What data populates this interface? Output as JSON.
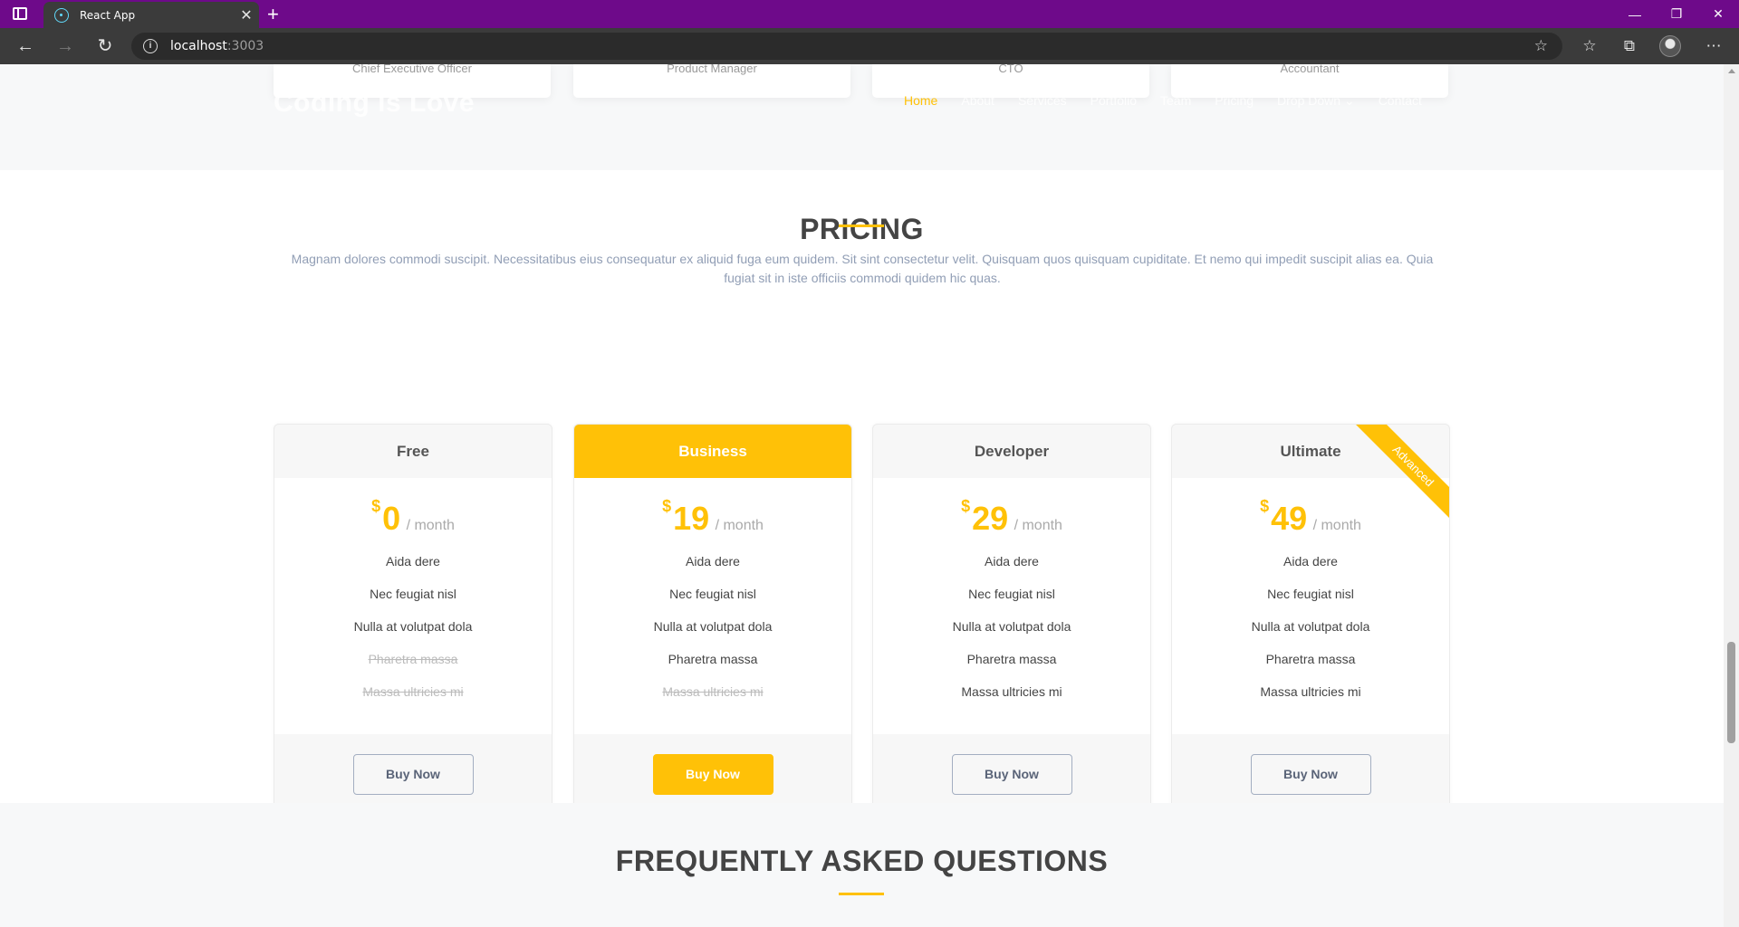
{
  "browser": {
    "tab_title": "React App",
    "tab_close": "✕",
    "new_tab": "+",
    "url_host": "localhost",
    "url_port": ":3003",
    "window": {
      "minimize": "—",
      "restore": "❐",
      "close": "✕"
    }
  },
  "team": {
    "roles": [
      "Chief Executive Officer",
      "Product Manager",
      "CTO",
      "Accountant"
    ]
  },
  "header": {
    "logo": "Coding is Love",
    "nav": [
      "Home",
      "About",
      "Services",
      "Portfolio",
      "Team",
      "Pricing",
      "Drop Down ⌄",
      "Contact"
    ]
  },
  "pricing": {
    "title": "PRICING",
    "description": "Magnam dolores commodi suscipit. Necessitatibus eius consequatur ex aliquid fuga eum quidem. Sit sint consectetur velit. Quisquam quos quisquam cupiditate. Et nemo qui impedit suscipit alias ea. Quia fugiat sit in iste officiis commodi quidem hic quas.",
    "plans": [
      {
        "name": "Free",
        "currency": "$",
        "amount": "0",
        "period": "/ month",
        "cta": "Buy Now",
        "features": [
          "Aida dere",
          "Nec feugiat nisl",
          "Nulla at volutpat dola",
          "Pharetra massa",
          "Massa ultricies mi"
        ],
        "included": [
          true,
          true,
          true,
          false,
          false
        ]
      },
      {
        "name": "Business",
        "currency": "$",
        "amount": "19",
        "period": "/ month",
        "cta": "Buy Now",
        "featured": true,
        "features": [
          "Aida dere",
          "Nec feugiat nisl",
          "Nulla at volutpat dola",
          "Pharetra massa",
          "Massa ultricies mi"
        ],
        "included": [
          true,
          true,
          true,
          true,
          false
        ]
      },
      {
        "name": "Developer",
        "currency": "$",
        "amount": "29",
        "period": "/ month",
        "cta": "Buy Now",
        "features": [
          "Aida dere",
          "Nec feugiat nisl",
          "Nulla at volutpat dola",
          "Pharetra massa",
          "Massa ultricies mi"
        ],
        "included": [
          true,
          true,
          true,
          true,
          true
        ]
      },
      {
        "name": "Ultimate",
        "currency": "$",
        "amount": "49",
        "period": "/ month",
        "cta": "Buy Now",
        "ribbon": "Advanced",
        "features": [
          "Aida dere",
          "Nec feugiat nisl",
          "Nulla at volutpat dola",
          "Pharetra massa",
          "Massa ultricies mi"
        ],
        "included": [
          true,
          true,
          true,
          true,
          true
        ]
      }
    ]
  },
  "faq": {
    "title": "FREQUENTLY ASKED QUESTIONS"
  },
  "colors": {
    "accent": "#ffc107",
    "titlebar": "#6e0a8a",
    "muted_text": "#919eb5"
  }
}
